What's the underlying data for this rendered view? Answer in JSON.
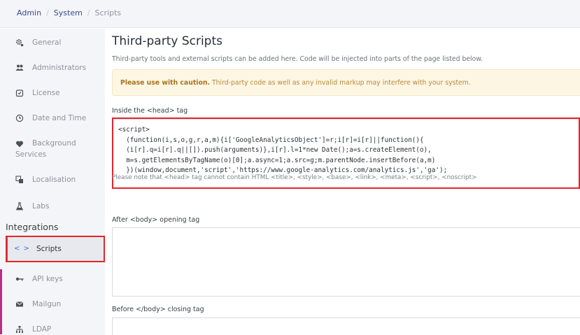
{
  "breadcrumb": {
    "admin": "Admin",
    "sep1": "/",
    "system": "System",
    "sep2": "/",
    "current": "Scripts"
  },
  "sidebar": {
    "items": [
      {
        "label": "General",
        "icon": "gear-icon"
      },
      {
        "label": "Administrators",
        "icon": "users-icon"
      },
      {
        "label": "License",
        "icon": "license-icon"
      },
      {
        "label": "Date and Time",
        "icon": "clock-icon"
      },
      {
        "label": "Background Services",
        "line1": "Background",
        "line2": "Services",
        "icon": "heart-icon"
      },
      {
        "label": "Localisation",
        "icon": "translate-icon"
      },
      {
        "label": "Labs",
        "icon": "flask-icon"
      }
    ],
    "section_heading": "Integrations",
    "active_item": {
      "code": "< >",
      "label": "Scripts"
    },
    "integration_items": [
      {
        "label": "API keys",
        "icon": "key-icon"
      },
      {
        "label": "Mailgun",
        "icon": "envelope-icon"
      },
      {
        "label": "LDAP",
        "icon": "ldap-icon"
      }
    ]
  },
  "main": {
    "title": "Third-party Scripts",
    "description": "Third-party tools and external scripts can be added here. Code will be injected into parts of the page listed below.",
    "warning": {
      "strong": "Please use with caution.",
      "text": " Third-party code as well as any invalid markup may interfere with your system."
    },
    "head_label": "Inside the <head> tag",
    "head_code": "<script>\n  (function(i,s,o,g,r,a,m){i['GoogleAnalyticsObject']=r;i[r]=i[r]||function(){\n  (i[r].q=i[r].q||[]).push(arguments)},i[r].l=1*new Date();a=s.createElement(o),\n  m=s.getElementsByTagName(o)[0];a.async=1;a.src=g;m.parentNode.insertBefore(a,m)\n  })(window,document,'script','https://www.google-analytics.com/analytics.js','ga');",
    "head_note": "Please note that <head> tag cannot contain HTML <title>, <style>, <base>, <link>, <meta>, <script>, <noscript>",
    "body_open_label": "After <body> opening tag",
    "body_close_label": "Before </body> closing tag"
  },
  "colors": {
    "highlight": "#e3262b",
    "active_accent": "#3a76c4",
    "sidebar_accent": "#b72f86",
    "warning_bg": "#fdf6e3"
  }
}
